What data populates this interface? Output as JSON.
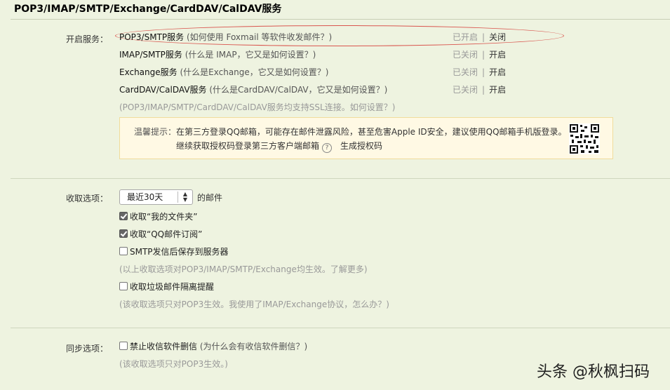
{
  "title": "POP3/IMAP/SMTP/Exchange/CardDAV/CalDAV服务",
  "services_label": "开启服务：",
  "services": [
    {
      "name": "POP3/SMTP服务",
      "hint": "(如何使用 Foxmail 等软件收发邮件？)",
      "status": "已开启",
      "action": "关闭"
    },
    {
      "name": "IMAP/SMTP服务",
      "hint": "(什么是 IMAP，它又是如何设置？)",
      "status": "已关闭",
      "action": "开启"
    },
    {
      "name": "Exchange服务",
      "hint": "(什么是Exchange，它又是如何设置？)",
      "status": "已关闭",
      "action": "开启"
    },
    {
      "name": "CardDAV/CalDAV服务",
      "hint": "(什么是CardDAV/CalDAV，它又是如何设置？)",
      "status": "已关闭",
      "action": "开启"
    }
  ],
  "status_separator": "|",
  "ssl_note": "(POP3/IMAP/SMTP/CardDAV/CalDAV服务均支持SSL连接。如何设置？)",
  "warning": {
    "label": "温馨提示：",
    "line1": "在第三方登录QQ邮箱，可能存在邮件泄露风险，甚至危害Apple ID安全，建议使用QQ邮箱手机版登录。",
    "line2": "继续获取授权码登录第三方客户端邮箱",
    "help_mark": "?",
    "generate_link": "生成授权码"
  },
  "receive": {
    "label": "收取选项：",
    "select_value": "最近30天",
    "select_suffix": "的邮件",
    "options": [
      {
        "label": "收取“我的文件夹”",
        "checked": true
      },
      {
        "label": "收取“QQ邮件订阅”",
        "checked": true
      },
      {
        "label": "SMTP发信后保存到服务器",
        "checked": false
      }
    ],
    "note1": "(以上收取选项对POP3/IMAP/SMTP/Exchange均生效。了解更多)",
    "spam_option": {
      "label": "收取垃圾邮件隔离提醒",
      "checked": false
    },
    "note2": "(该收取选项只对POP3生效。我使用了IMAP/Exchange协议，怎么办？)"
  },
  "sync": {
    "label": "同步选项：",
    "option": {
      "label": "禁止收信软件删信",
      "hint": "(为什么会有收信软件删信？)",
      "checked": false
    },
    "note": "(该收取选项只对POP3生效。)"
  },
  "watermark": "头条 @秋枫扫码",
  "colors": {
    "background": "#eef3e0",
    "annotation": "#d9554e",
    "warning_bg": "#fff9e4"
  }
}
